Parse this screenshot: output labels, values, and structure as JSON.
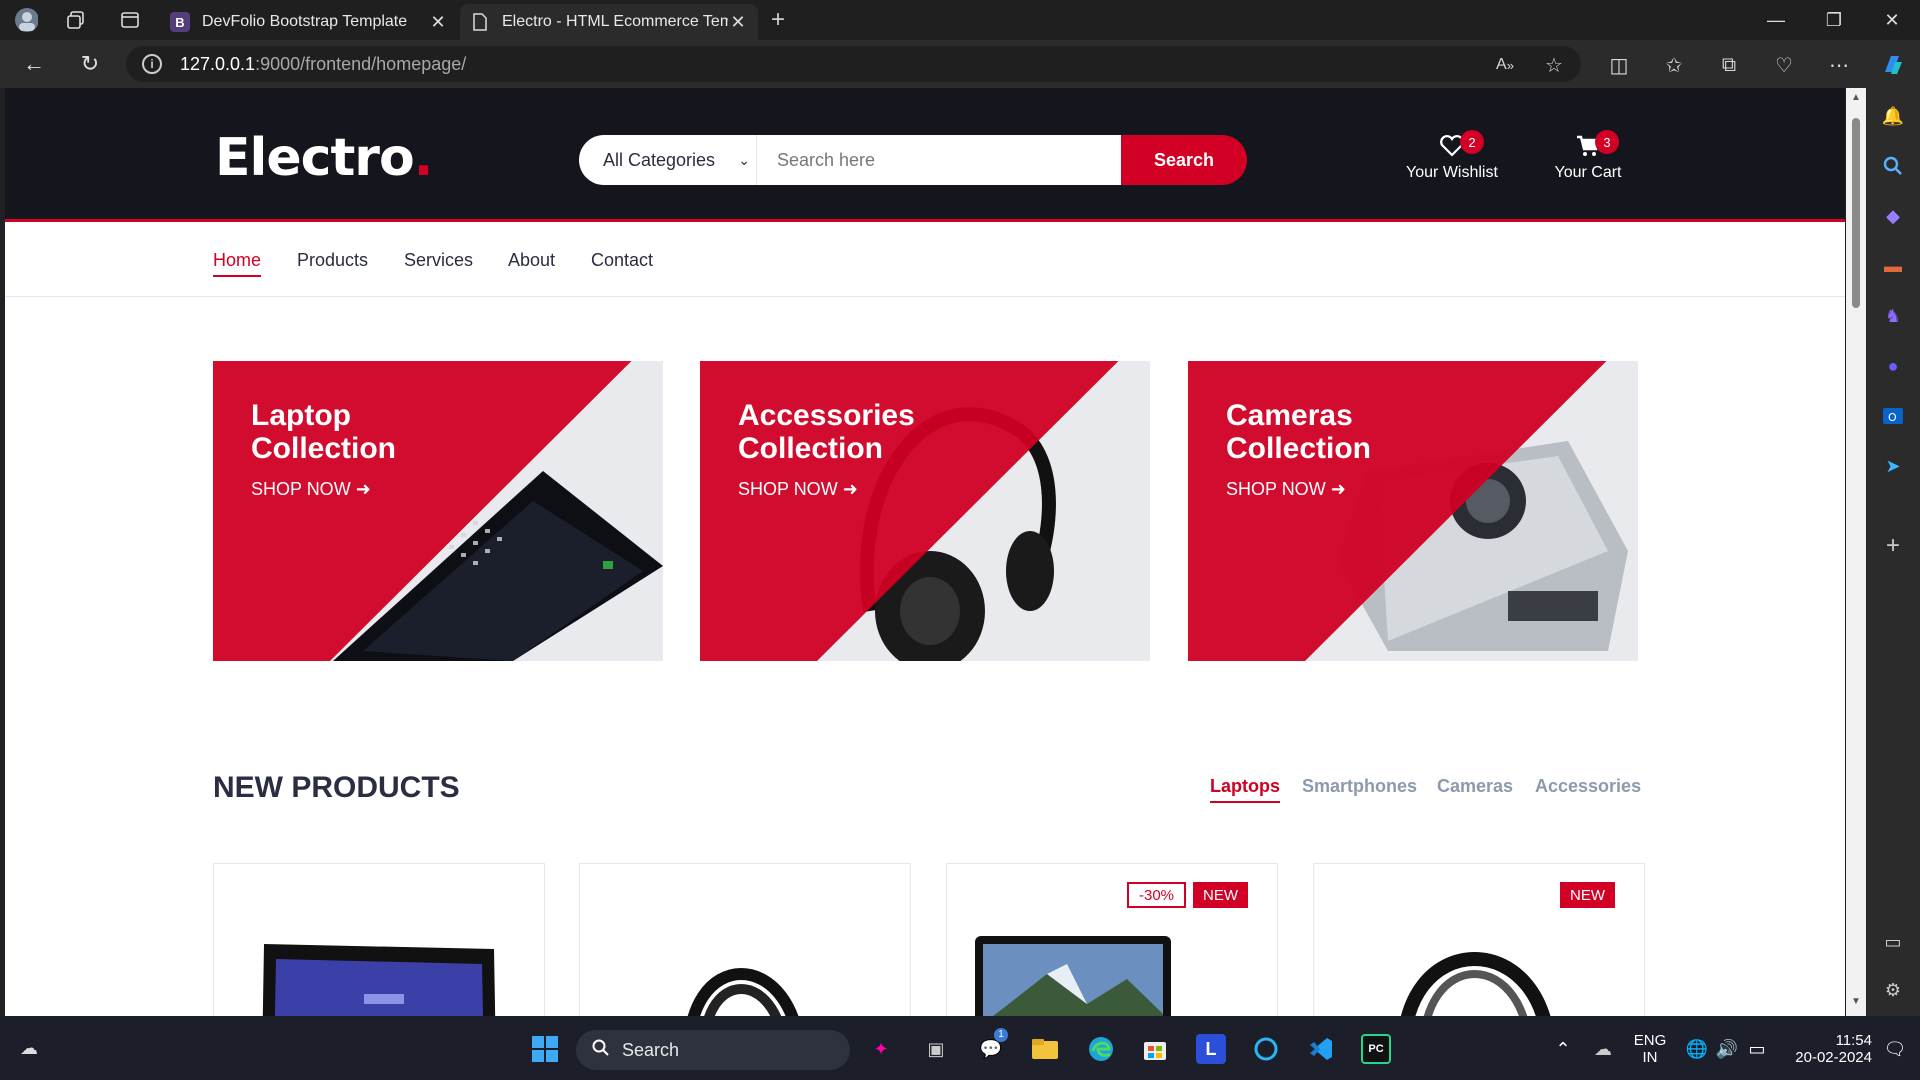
{
  "browser": {
    "tabs": [
      {
        "title": "DevFolio Bootstrap Template",
        "favicon": "B"
      },
      {
        "title": "Electro - HTML Ecommerce Temp",
        "favicon": "page-icon"
      }
    ],
    "url_host": "127.0.0.1",
    "url_path": ":9000/frontend/homepage/"
  },
  "site": {
    "logo_text": "Electro",
    "logo_dot": ".",
    "category_select": "All Categories",
    "search_placeholder": "Search here",
    "search_button": "Search",
    "wishlist": {
      "label": "Your Wishlist",
      "count": "2"
    },
    "cart": {
      "label": "Your Cart",
      "count": "3"
    },
    "nav": [
      "Home",
      "Products",
      "Services",
      "About",
      "Contact"
    ],
    "nav_active": "Home",
    "collections": [
      {
        "line1": "Laptop",
        "line2": "Collection",
        "cta": "SHOP NOW"
      },
      {
        "line1": "Accessories",
        "line2": "Collection",
        "cta": "SHOP NOW"
      },
      {
        "line1": "Cameras",
        "line2": "Collection",
        "cta": "SHOP NOW"
      }
    ],
    "new_products": {
      "title": "NEW PRODUCTS",
      "tabs": [
        "Laptops",
        "Smartphones",
        "Cameras",
        "Accessories"
      ],
      "active_tab": "Laptops",
      "products": [
        {
          "image": "tablet",
          "sale": "",
          "new": ""
        },
        {
          "image": "headphones",
          "sale": "",
          "new": ""
        },
        {
          "image": "laptop",
          "sale": "-30%",
          "new": "NEW"
        },
        {
          "image": "headphones",
          "sale": "",
          "new": "NEW"
        }
      ]
    },
    "colors": {
      "brand_red": "#d10024",
      "header_dark": "#15161d",
      "text_dark": "#2b2d42",
      "muted": "#8d99ae"
    }
  },
  "taskbar": {
    "search": "Search",
    "lang1": "ENG",
    "lang2": "IN",
    "time": "11:54",
    "date": "20-02-2024",
    "teams_badge": "1"
  }
}
